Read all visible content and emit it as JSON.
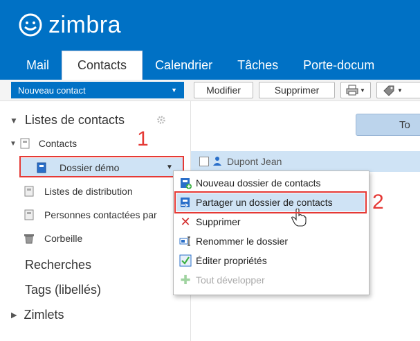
{
  "app": {
    "logo_text": "zimbra"
  },
  "tabs": [
    {
      "label": "Mail"
    },
    {
      "label": "Contacts"
    },
    {
      "label": "Calendrier"
    },
    {
      "label": "Tâches"
    },
    {
      "label": "Porte-docum"
    }
  ],
  "toolbar": {
    "new_label": "Nouveau contact",
    "modify_label": "Modifier",
    "delete_label": "Supprimer"
  },
  "sidebar": {
    "contact_lists": "Listes de contacts",
    "contacts": "Contacts",
    "demo_folder": "Dossier démo",
    "distribution_lists": "Listes de distribution",
    "contacted_people": "Personnes contactées par",
    "trash": "Corbeille",
    "searches": "Recherches",
    "tags": "Tags (libellés)",
    "zimlets": "Zimlets"
  },
  "main": {
    "all_button": "To",
    "row_name": "Dupont Jean"
  },
  "context_menu": {
    "items": [
      {
        "label": "Nouveau dossier de contacts",
        "icon": "new-contacts-folder-icon"
      },
      {
        "label": "Partager un dossier de contacts",
        "icon": "share-folder-icon"
      },
      {
        "label": "Supprimer",
        "icon": "delete-x-icon"
      },
      {
        "label": "Renommer le dossier",
        "icon": "rename-icon"
      },
      {
        "label": "Éditer propriétés",
        "icon": "edit-properties-icon"
      },
      {
        "label": "Tout développer",
        "icon": "expand-plus-icon",
        "disabled": true
      }
    ]
  },
  "annotations": {
    "step1": "1",
    "step2": "2"
  },
  "colors": {
    "brand": "#0071c5",
    "highlight": "#e53935",
    "selected_row": "#cfe3f5"
  }
}
